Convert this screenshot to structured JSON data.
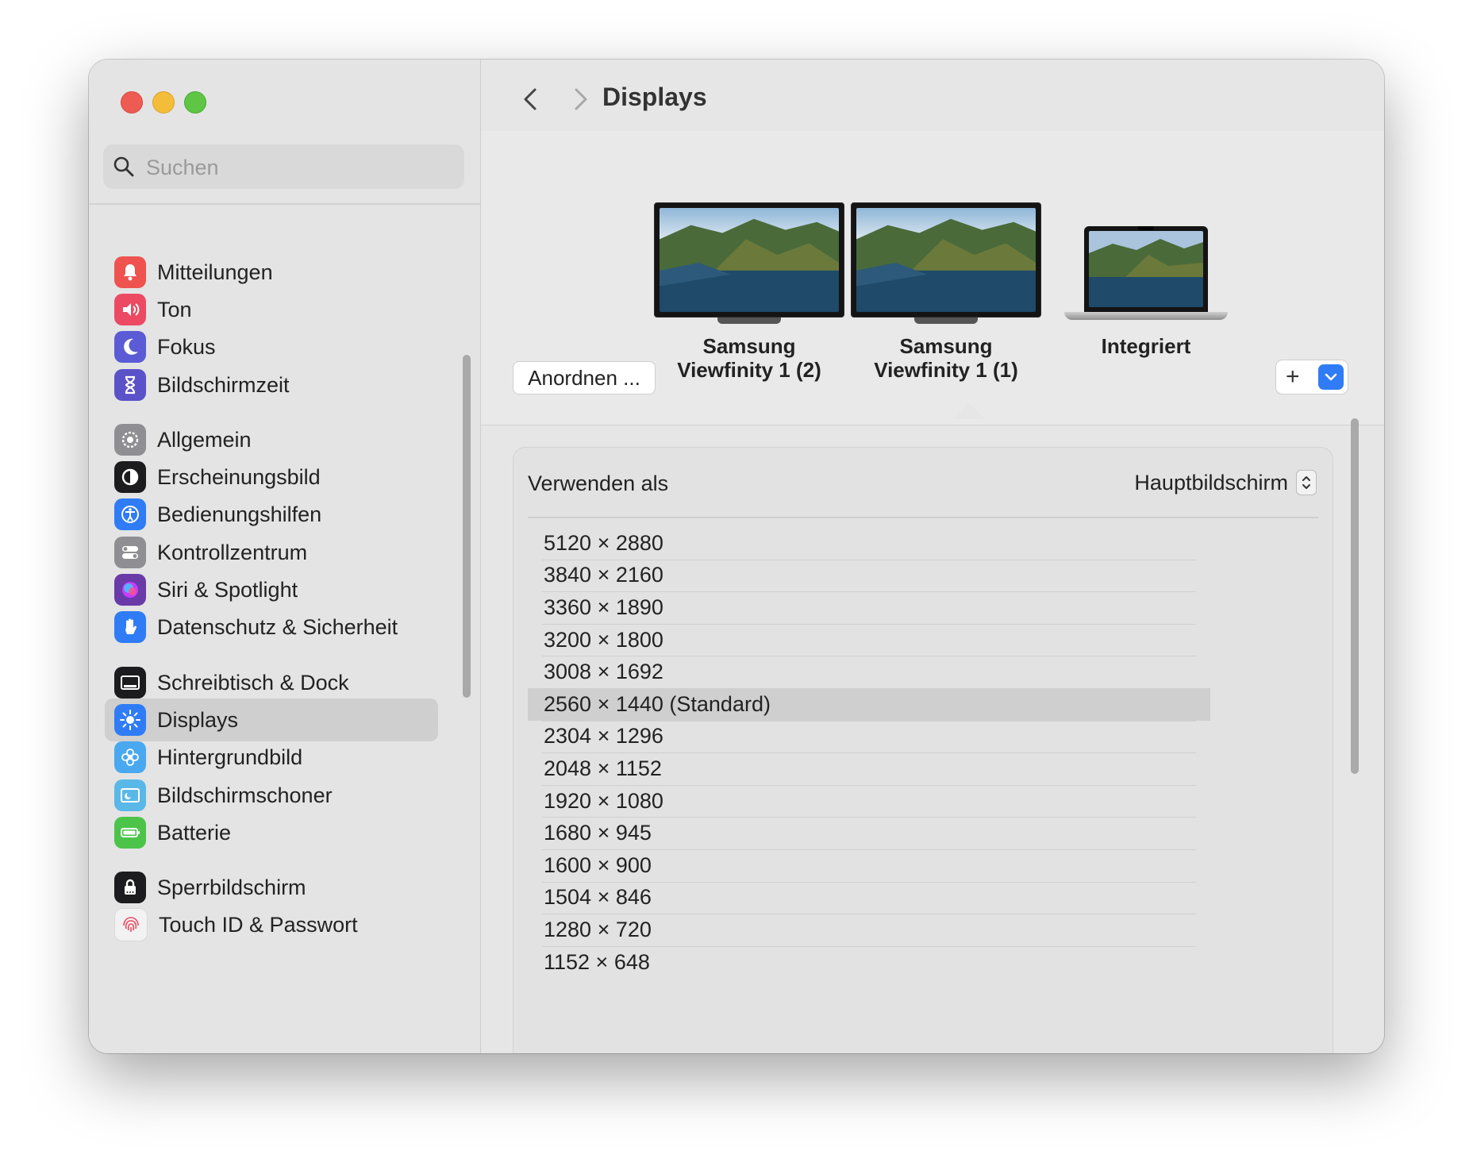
{
  "window": {
    "title": "Displays"
  },
  "search": {
    "placeholder": "Suchen"
  },
  "sidebar": {
    "items": [
      {
        "label": "Mitteilungen",
        "icon": "bell-icon",
        "color": "#ee5350"
      },
      {
        "label": "Ton",
        "icon": "speaker-icon",
        "color": "#ec4a63"
      },
      {
        "label": "Fokus",
        "icon": "moon-icon",
        "color": "#5b5bd6"
      },
      {
        "label": "Bildschirmzeit",
        "icon": "hourglass-icon",
        "color": "#5b52c9"
      },
      {
        "label": "Allgemein",
        "icon": "gear-icon",
        "color": "#8e8e93"
      },
      {
        "label": "Erscheinungsbild",
        "icon": "appearance-icon",
        "color": "#1c1c1e"
      },
      {
        "label": "Bedienungshilfen",
        "icon": "accessibility-icon",
        "color": "#2f7cf6"
      },
      {
        "label": "Kontrollzentrum",
        "icon": "toggles-icon",
        "color": "#8e8e93"
      },
      {
        "label": "Siri & Spotlight",
        "icon": "siri-icon",
        "color": "#6a3aa8"
      },
      {
        "label": "Datenschutz & Sicherheit",
        "icon": "hand-icon",
        "color": "#2f7cf6"
      },
      {
        "label": "Schreibtisch & Dock",
        "icon": "dock-icon",
        "color": "#1c1c1e"
      },
      {
        "label": "Displays",
        "icon": "sun-icon",
        "color": "#2f7cf6"
      },
      {
        "label": "Hintergrundbild",
        "icon": "flower-icon",
        "color": "#49a8f0"
      },
      {
        "label": "Bildschirmschoner",
        "icon": "screensaver-icon",
        "color": "#5ab8e8"
      },
      {
        "label": "Batterie",
        "icon": "battery-icon",
        "color": "#4cc44a"
      },
      {
        "label": "Sperrbildschirm",
        "icon": "lock-icon",
        "color": "#1c1c1e"
      },
      {
        "label": "Touch ID & Passwort",
        "icon": "fingerprint-icon",
        "color": "#f2f2f2"
      }
    ],
    "selected": "Displays"
  },
  "toolbar": {
    "arrange_label": "Anordnen ...",
    "add_label": "+"
  },
  "displays": [
    {
      "name": "Samsung Viewfinity 1 (2)",
      "line1": "Samsung",
      "line2": "Viewfinity 1 (2)"
    },
    {
      "name": "Samsung Viewfinity 1 (1)",
      "line1": "Samsung",
      "line2": "Viewfinity 1 (1)",
      "selected": true
    },
    {
      "name": "Integriert",
      "line1": "Integriert",
      "line2": ""
    }
  ],
  "settings": {
    "use_as_label": "Verwenden als",
    "use_as_value": "Hauptbildschirm",
    "resolutions": [
      "5120 × 2880",
      "3840 × 2160",
      "3360 × 1890",
      "3200 × 1800",
      "3008 × 1692",
      "2560 × 1440 (Standard)",
      "2304 × 1296",
      "2048 × 1152",
      "1920 × 1080",
      "1680 × 945",
      "1600 × 900",
      "1504 × 846",
      "1280 × 720",
      "1152 × 648"
    ],
    "selected_resolution": "2560 × 1440 (Standard)"
  },
  "colors": {
    "accent": "#2f7cf6",
    "window_bg": "#e6e6e6",
    "selection_bg": "#cfcfcf"
  }
}
